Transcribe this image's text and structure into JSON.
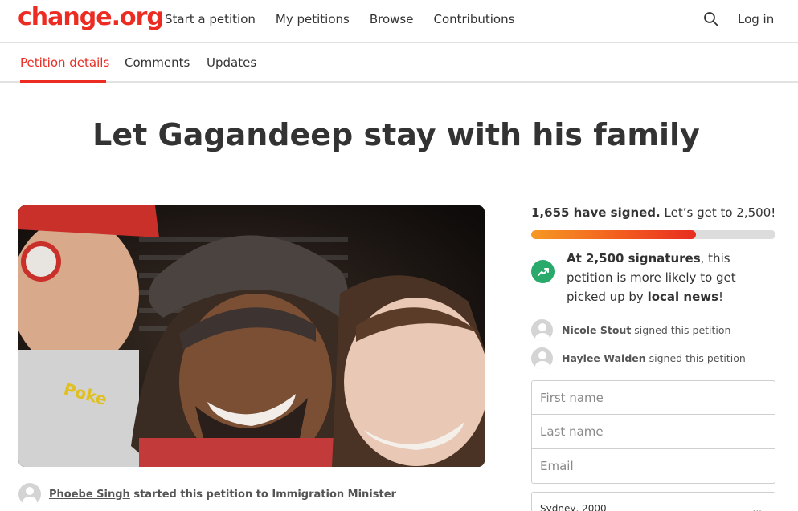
{
  "brand": {
    "logo_text": "change.org",
    "accent": "#ec2c22"
  },
  "nav": {
    "links": [
      "Start a petition",
      "My petitions",
      "Browse",
      "Contributions"
    ],
    "login": "Log in",
    "search_icon": "search-icon"
  },
  "tabs": [
    {
      "label": "Petition details",
      "active": true
    },
    {
      "label": "Comments",
      "active": false
    },
    {
      "label": "Updates",
      "active": false
    }
  ],
  "petition": {
    "title": "Let Gagandeep stay with his family",
    "starter_name": "Phoebe Singh",
    "starter_suffix": "started this petition to Immigration Minister"
  },
  "signatures": {
    "count_text": "1,655 have signed.",
    "goal_text": "Let’s get to 2,500!",
    "progress_fraction": 0.674,
    "promo_prefix": "At 2,500 signatures",
    "promo_middle": ", this petition is more likely to get picked up by ",
    "promo_bold_end": "local news",
    "promo_suffix": "!",
    "recent_signers": [
      {
        "name": "Nicole Stout",
        "action": "signed this petition"
      },
      {
        "name": "Haylee Walden",
        "action": "signed this petition"
      }
    ]
  },
  "form": {
    "first_name_placeholder": "First name",
    "last_name_placeholder": "Last name",
    "email_placeholder": "Email",
    "location_value": "Sydney, 2000",
    "location_ellipsis": "..."
  }
}
